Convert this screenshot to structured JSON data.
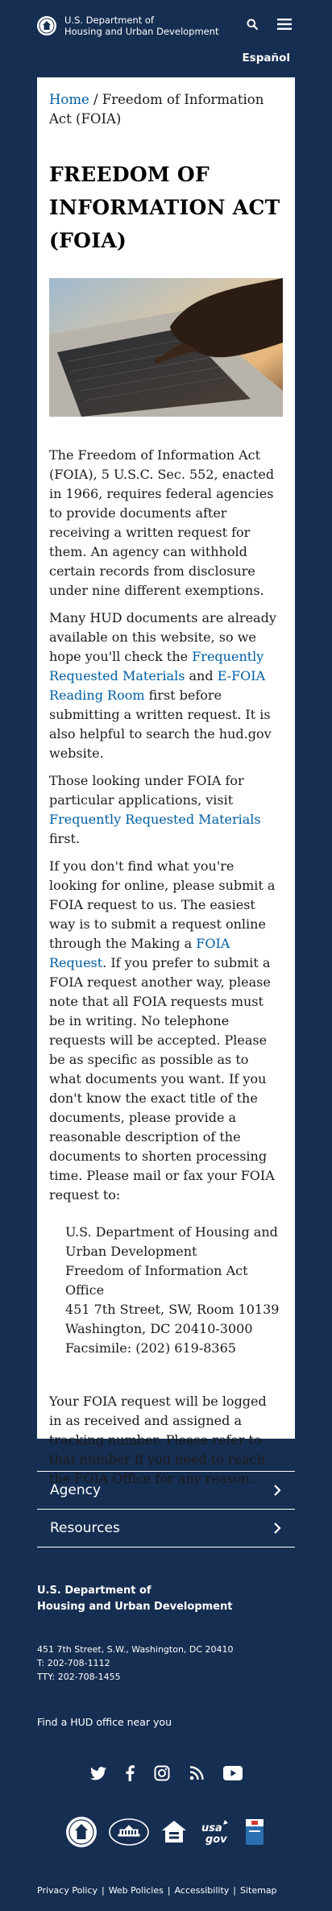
{
  "header": {
    "agency_line1": "U.S. Department of",
    "agency_line2": "Housing and Urban Development",
    "language_link": "Español"
  },
  "breadcrumb": {
    "home": "Home",
    "separator": " / ",
    "current": "Freedom of Information Act (FOIA)"
  },
  "page": {
    "title": "FREEDOM OF INFORMATION ACT (FOIA)"
  },
  "content": {
    "p1": "The Freedom of Information Act (FOIA), 5 U.S.C. Sec. 552, enacted in 1966, requires federal agencies to provide documents after receiving a written request for them. An agency can withhold certain records from disclosure under nine different exemptions.",
    "p2_a": "Many HUD documents are already available on this website, so we hope you'll check the ",
    "p2_link1": "Frequently Requested Materials",
    "p2_b": " and ",
    "p2_link2": "E-FOIA Reading Room",
    "p2_c": " first before submitting a written request. It is also helpful to search the hud.gov website.",
    "p3_a": "Those looking under FOIA for particular applications, visit ",
    "p3_link": "Frequently Requested Materials",
    "p3_b": " first.",
    "p4_a": "If you don't find what you're looking for online, please submit a FOIA request to us. The easiest way is to submit a request online through the Making a ",
    "p4_link": "FOIA Request",
    "p4_b": ". If you prefer to submit a FOIA request another way, please note that all FOIA requests must be in writing. No telephone requests will be accepted. Please be as specific as possible as to what documents you want. If you don't know the exact title of the documents, please provide a reasonable description of the documents to shorten processing time. Please mail or fax your FOIA request to:",
    "address": [
      "U.S. Department of Housing and Urban Development",
      "Freedom of Information Act Office",
      "451 7th Street, SW, Room 10139",
      "Washington, DC 20410-3000",
      "Facsimile: (202) 619-8365"
    ],
    "p5": "Your FOIA request will be logged in as received and assigned a tracking number. Please refer to that number if you need to reach the FOIA Office for any reason."
  },
  "footer": {
    "accordion": [
      {
        "label": "Agency"
      },
      {
        "label": "Resources"
      }
    ],
    "title_line1": "U.S. Department of",
    "title_line2": "Housing and Urban Development",
    "address_line": "451 7th Street, S.W., Washington, DC 20410",
    "phone": "T: 202-708-1112",
    "tty": "TTY: 202-708-1455",
    "find_office": "Find a HUD office near you",
    "links": [
      "Privacy Policy",
      "Web Policies",
      "Accessibility",
      "Sitemap"
    ],
    "link_separator": "|"
  },
  "colors": {
    "navy": "#162e51",
    "link": "#005ea2"
  }
}
